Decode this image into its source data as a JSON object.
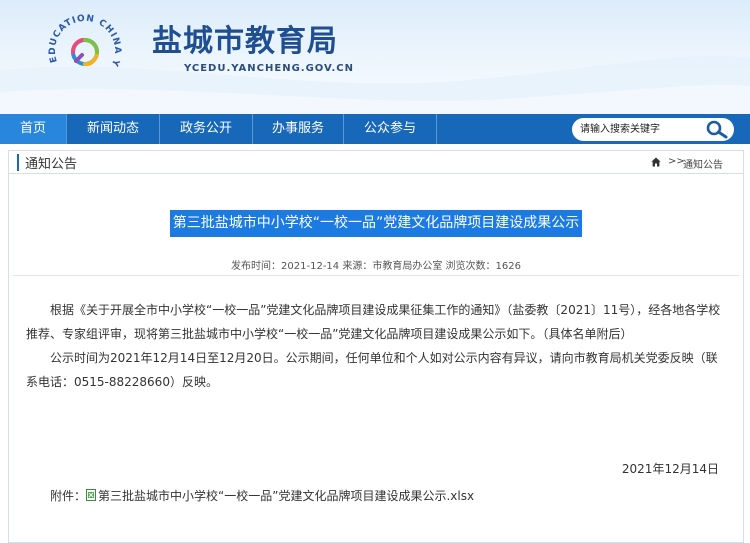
{
  "header": {
    "site_title": "盐城市教育局",
    "domain": "YCEDU.YANCHENG.GOV.CN",
    "logo_text_top": "EDUCATION CHINA",
    "logo_text_side": "YANCHENG"
  },
  "nav": {
    "items": [
      {
        "label": "首页",
        "active": true
      },
      {
        "label": "新闻动态"
      },
      {
        "label": "政务公开"
      },
      {
        "label": "办事服务"
      },
      {
        "label": "公众参与"
      }
    ],
    "search_placeholder": "请输入搜索关键字"
  },
  "breadcrumb": {
    "section_title": "通知公告",
    "separator": ">>",
    "current": "通知公告"
  },
  "article": {
    "title": "第三批盐城市中小学校“一校一品”党建文化品牌项目建设成果公示",
    "meta": "发布时间：2021-12-14 来源：市教育局办公室 浏览次数：1626",
    "paragraphs": [
      "根据《关于开展全市中小学校“一校一品”党建文化品牌项目建设成果征集工作的通知》（盐委教〔2021〕11号），经各地各学校推荐、专家组评审，现将第三批盐城市中小学校“一校一品”党建文化品牌项目建设成果公示如下。（具体名单附后）",
      "公示时间为2021年12月14日至12月20日。公示期间，任何单位和个人如对公示内容有异议，请向市教育局机关党委反映（联系电话：0515-88228660）反映。"
    ],
    "date": "2021年12月14日",
    "attachment_label": "附件：",
    "attachment_name": "第三批盐城市中小学校“一校一品”党建文化品牌项目建设成果公示.xlsx"
  },
  "colors": {
    "nav_bg": "#1768b8",
    "nav_active": "#2a86dc",
    "title_highlight": "#1c7be2",
    "site_title": "#1f4f92"
  }
}
